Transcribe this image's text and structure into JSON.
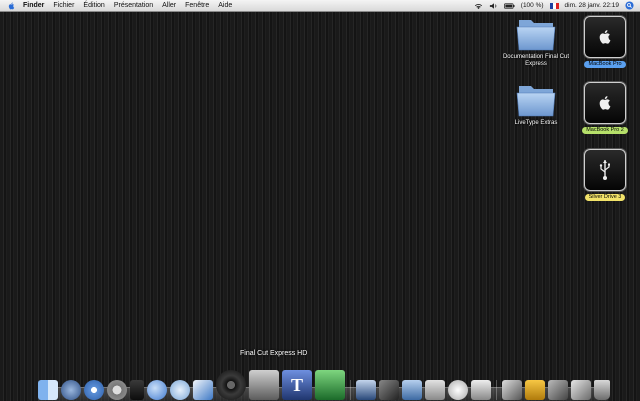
{
  "menubar": {
    "app": "Finder",
    "items": [
      "Fichier",
      "Édition",
      "Présentation",
      "Aller",
      "Fenêtre",
      "Aide"
    ],
    "battery": "(100 %)",
    "clock": "dim. 28 janv. 22:19"
  },
  "desktop": {
    "folders": [
      {
        "label": "Documentation Final Cut Express"
      },
      {
        "label": "LiveType Extras"
      }
    ],
    "drives": [
      {
        "label": "MacBook Pro",
        "color": "#5aa0f0"
      },
      {
        "label": "MacBook Pro 2",
        "color": "#b6e06a"
      },
      {
        "label": "Silver Drive 3",
        "color": "#f2e36a"
      }
    ]
  },
  "dock": {
    "tooltip": "Final Cut Express HD",
    "icons": [
      "finder-icon",
      "dashboard-icon",
      "safari-icon",
      "system-preferences-icon",
      "itunes-icon",
      "ichat-icon",
      "mail-icon",
      "feather-app-icon",
      "dvd-camera-icon",
      "final-cut-express-icon",
      "livetype-icon",
      "soundtrack-icon",
      "compressor-icon",
      "photo-app-icon",
      "iphoto-icon",
      "preview-icon",
      "apple-icon",
      "printer-icon",
      "tools-icon",
      "office-icon",
      "pen-icon",
      "script-icon",
      "trash-icon"
    ]
  }
}
